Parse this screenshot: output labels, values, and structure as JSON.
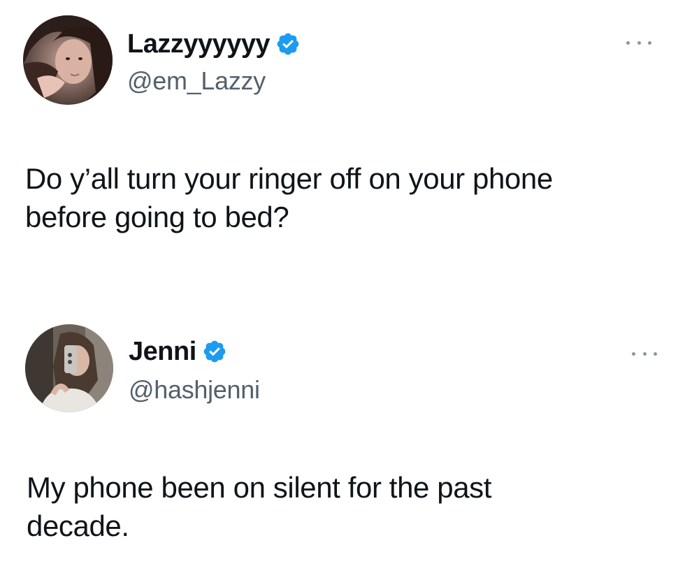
{
  "tweets": [
    {
      "display_name": "Lazzyyyyyy",
      "handle": "@em_Lazzy",
      "verified": true,
      "text_lines": [
        "Do y’all turn your ringer off on your phone",
        "before going to bed?"
      ],
      "avatar_icon": "profile-photo"
    },
    {
      "display_name": "Jenni",
      "handle": "@hashjenni",
      "verified": true,
      "text_lines": [
        "My phone been on silent for the past",
        "decade."
      ],
      "avatar_icon": "profile-photo"
    }
  ],
  "colors": {
    "verified_blue": "#1d9bf0",
    "text_primary": "#0f1419",
    "text_secondary": "#53606c",
    "more_dots": "#8a96a1"
  },
  "icons": {
    "verified": "verified-badge-icon",
    "more": "more-options-icon"
  }
}
